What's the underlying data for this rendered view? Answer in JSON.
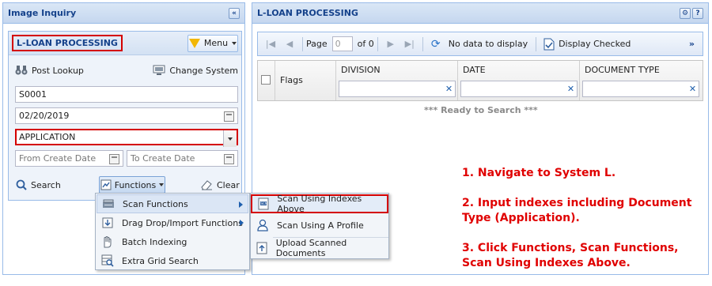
{
  "left_panel": {
    "title": "Image Inquiry",
    "collapse_icon": "double-chevron-left-icon",
    "system_title": "L-LOAN PROCESSING",
    "menu_label": "Menu",
    "post_lookup_label": "Post Lookup",
    "change_system_label": "Change System",
    "field1_value": "S0001",
    "date_value": "02/20/2019",
    "doc_type_value": "APPLICATION",
    "from_date_placeholder": "From Create Date",
    "to_date_placeholder": "To Create Date",
    "search_label": "Search",
    "functions_label": "Functions",
    "clear_label": "Clear"
  },
  "functions_menu": {
    "items": [
      {
        "label": "Scan Functions",
        "icon": "scanner-icon",
        "has_submenu": true
      },
      {
        "label": "Drag Drop/Import Functions",
        "icon": "import-icon",
        "has_submenu": true
      },
      {
        "label": "Batch Indexing",
        "icon": "hand-icon",
        "has_submenu": false
      },
      {
        "label": "Extra Grid Search",
        "icon": "grid-search-icon",
        "has_submenu": false
      }
    ]
  },
  "scan_submenu": {
    "items": [
      {
        "label": "Scan Using Indexes Above",
        "icon": "scan-doc-icon"
      },
      {
        "label": "Scan Using A Profile",
        "icon": "user-icon"
      },
      {
        "label": "Upload Scanned Documents",
        "icon": "upload-icon"
      }
    ]
  },
  "right_panel": {
    "title": "L-LOAN PROCESSING",
    "toolbar": {
      "page_label": "Page",
      "page_value": "0",
      "of_label": "of 0",
      "status": "No data to display",
      "display_checked_label": "Display Checked"
    },
    "columns": [
      "Flags",
      "DIVISION",
      "DATE",
      "DOCUMENT TYPE"
    ],
    "ready_text": "*** Ready to Search ***"
  },
  "instructions": [
    "1. Navigate to System L.",
    "2. Input indexes including Document Type (Application).",
    "3. Click Functions, Scan Functions, Scan Using Indexes Above."
  ],
  "colors": {
    "header_text": "#15428b",
    "highlight_border": "#d40000",
    "instruction_text": "#e00000"
  }
}
